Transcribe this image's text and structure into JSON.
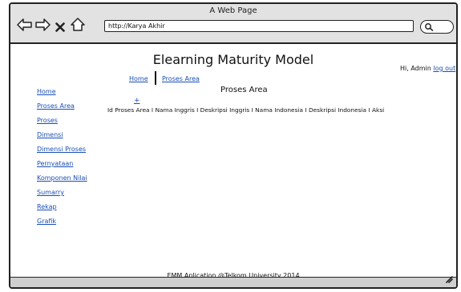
{
  "window": {
    "title": "A Web Page",
    "url": "http://Karya Akhir"
  },
  "page": {
    "title": "Elearning Maturity Model",
    "greeting_prefix": "Hi, Admin",
    "logout_label": "log out",
    "greeting_suffix": "?"
  },
  "breadcrumb": {
    "home": "Home",
    "current": "Proses Area"
  },
  "sidebar": {
    "items": [
      {
        "label": "Home"
      },
      {
        "label": "Proses Area"
      },
      {
        "label": "Proses"
      },
      {
        "label": "Dimensi"
      },
      {
        "label": "Dimensi Proses"
      },
      {
        "label": "Pernyataan"
      },
      {
        "label": "Komponen Nilai"
      },
      {
        "label": "Sumarry"
      },
      {
        "label": "Rekap"
      },
      {
        "label": "Grafik"
      }
    ]
  },
  "content": {
    "section_title": "Proses Area",
    "add_label": "+",
    "columns": [
      "Id Proses Area",
      "Nama Inggris",
      "Deskripsi Inggris",
      "Nama Indonesia",
      "Deskripsi Indonesia",
      "Aksi"
    ],
    "column_separator": " I "
  },
  "footer": {
    "text": "EMM Aplication @Telkom University 2014"
  },
  "icons": {
    "back": "arrow-left-icon",
    "forward": "arrow-right-icon",
    "stop": "close-icon",
    "home": "home-icon",
    "search": "search-icon",
    "resize": "resize-grip-icon"
  }
}
